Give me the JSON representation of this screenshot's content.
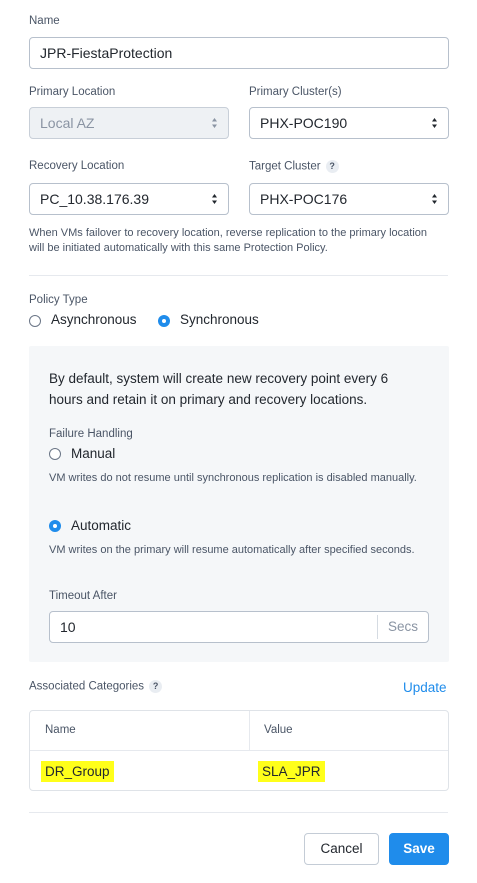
{
  "form": {
    "name_label": "Name",
    "name_value": "JPR-FiestaProtection",
    "primary_location_label": "Primary Location",
    "primary_location_value": "Local AZ",
    "primary_cluster_label": "Primary Cluster(s)",
    "primary_cluster_value": "PHX-POC190",
    "recovery_location_label": "Recovery Location",
    "recovery_location_value": "PC_10.38.176.39",
    "target_cluster_label": "Target Cluster",
    "target_cluster_value": "PHX-POC176",
    "help_glyph": "?",
    "failover_hint": "When VMs failover to recovery location, reverse replication to the primary location will be initiated automatically with this same Protection Policy."
  },
  "policy": {
    "type_label": "Policy Type",
    "options": [
      "Asynchronous",
      "Synchronous"
    ],
    "selected": "Synchronous"
  },
  "sync_panel": {
    "description": "By default, system will create new recovery point every 6 hours and retain it on primary and recovery locations.",
    "failure_handling_label": "Failure Handling",
    "manual_label": "Manual",
    "manual_hint": "VM writes do not resume until synchronous replication is disabled manually.",
    "automatic_label": "Automatic",
    "automatic_hint": "VM writes on the primary will resume automatically after specified seconds.",
    "selected": "Automatic",
    "timeout_label": "Timeout After",
    "timeout_value": "10",
    "timeout_unit": "Secs"
  },
  "categories": {
    "label": "Associated Categories",
    "update_label": "Update",
    "columns": [
      "Name",
      "Value"
    ],
    "rows": [
      {
        "name": "DR_Group",
        "value": "SLA_JPR"
      }
    ]
  },
  "footer": {
    "cancel_label": "Cancel",
    "save_label": "Save"
  },
  "colors": {
    "accent": "#1f8ceb",
    "highlight": "#ffff1a",
    "panel_bg": "#f5f7f9"
  }
}
